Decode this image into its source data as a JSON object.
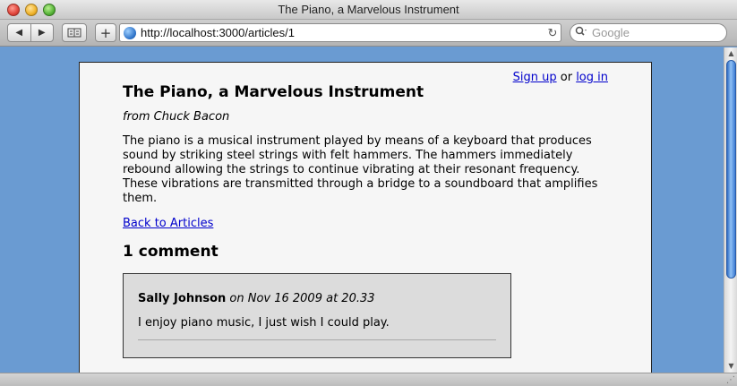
{
  "window": {
    "title": "The Piano, a Marvelous Instrument"
  },
  "toolbar": {
    "back_icon": "◀",
    "forward_icon": "▶",
    "add_bookmark_label": "+",
    "url": "http://localhost:3000/articles/1",
    "reload_icon": "↻",
    "search_placeholder": "Google",
    "search_icon": "🔍"
  },
  "page": {
    "user_nav": {
      "sign_up": "Sign up",
      "separator": "or",
      "log_in": "log in"
    },
    "article": {
      "title": "The Piano, a Marvelous Instrument",
      "author": "from Chuck Bacon",
      "body": "The piano is a musical instrument played by means of a keyboard that produces sound by striking steel strings with felt hammers. The hammers immediately rebound allowing the strings to continue vibrating at their resonant frequency. These vibrations are transmitted through a bridge to a soundboard that amplifies them.",
      "back_link": "Back to Articles"
    },
    "comments": {
      "heading": "1 comment",
      "items": [
        {
          "author": "Sally Johnson",
          "date": "on Nov 16 2009 at 20.33",
          "text": "I enjoy piano music, I just wish I could play."
        }
      ]
    }
  },
  "colors": {
    "page_background": "#6a9bd2",
    "container_background": "#f6f6f6",
    "comment_background": "#dcdcdc",
    "link": "#0000cc"
  }
}
